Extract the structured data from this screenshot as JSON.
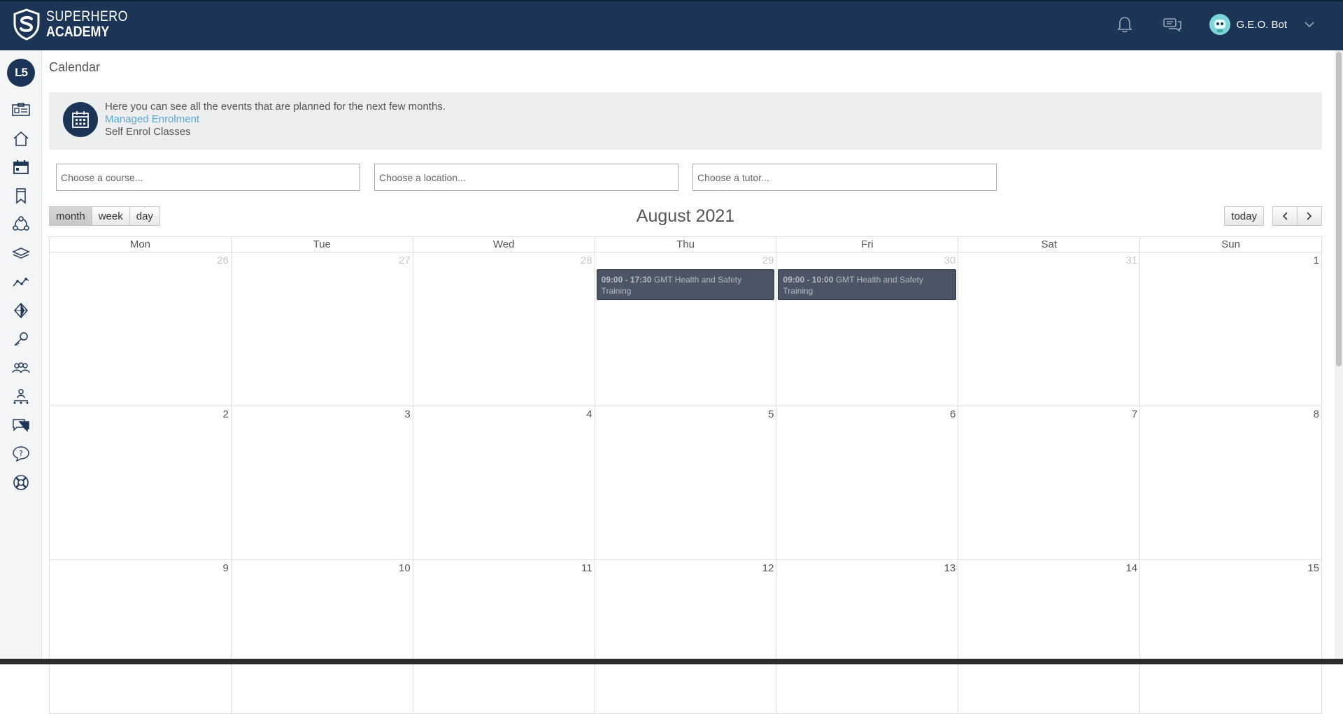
{
  "header": {
    "logo_line1": "SUPERHERO",
    "logo_line2": "ACADEMY",
    "user_name": "G.E.O. Bot"
  },
  "sidebar": {
    "level": "L5",
    "icons": [
      "id-card-icon",
      "home-icon",
      "calendar-icon",
      "bookmark-icon",
      "network-icon",
      "layers-icon",
      "trend-icon",
      "diamond-icon",
      "key-icon",
      "group-icon",
      "org-chart-icon",
      "chat-icon",
      "help-icon",
      "lifebuoy-icon"
    ]
  },
  "page": {
    "title": "Calendar"
  },
  "info": {
    "text": "Here you can see all the events that are planned for the next few months.",
    "link": "Managed Enrolment",
    "subtext": "Self Enrol Classes"
  },
  "filters": {
    "course_placeholder": "Choose a course...",
    "location_placeholder": "Choose a location...",
    "tutor_placeholder": "Choose a tutor..."
  },
  "view": {
    "month": "month",
    "week": "week",
    "day": "day",
    "today": "today",
    "prev": "<",
    "next": ">"
  },
  "calendar": {
    "title": "August 2021",
    "weekdays": [
      "Mon",
      "Tue",
      "Wed",
      "Thu",
      "Fri",
      "Sat",
      "Sun"
    ],
    "weeks": [
      [
        {
          "n": "26",
          "other": true
        },
        {
          "n": "27",
          "other": true
        },
        {
          "n": "28",
          "other": true
        },
        {
          "n": "29",
          "other": true
        },
        {
          "n": "30",
          "other": true
        },
        {
          "n": "31",
          "other": true
        },
        {
          "n": "1",
          "other": false
        }
      ],
      [
        {
          "n": "2",
          "other": false
        },
        {
          "n": "3",
          "other": false
        },
        {
          "n": "4",
          "other": false
        },
        {
          "n": "5",
          "other": false
        },
        {
          "n": "6",
          "other": false
        },
        {
          "n": "7",
          "other": false
        },
        {
          "n": "8",
          "other": false
        }
      ],
      [
        {
          "n": "9",
          "other": false
        },
        {
          "n": "10",
          "other": false
        },
        {
          "n": "11",
          "other": false
        },
        {
          "n": "12",
          "other": false
        },
        {
          "n": "13",
          "other": false
        },
        {
          "n": "14",
          "other": false
        },
        {
          "n": "15",
          "other": false
        }
      ]
    ],
    "events": [
      {
        "week": 0,
        "day": 3,
        "time": "09:00 - 17:30",
        "title": "GMT Health and Safety Training"
      },
      {
        "week": 0,
        "day": 4,
        "time": "09:00 - 10:00",
        "title": "GMT Health and Safety Training"
      }
    ]
  }
}
